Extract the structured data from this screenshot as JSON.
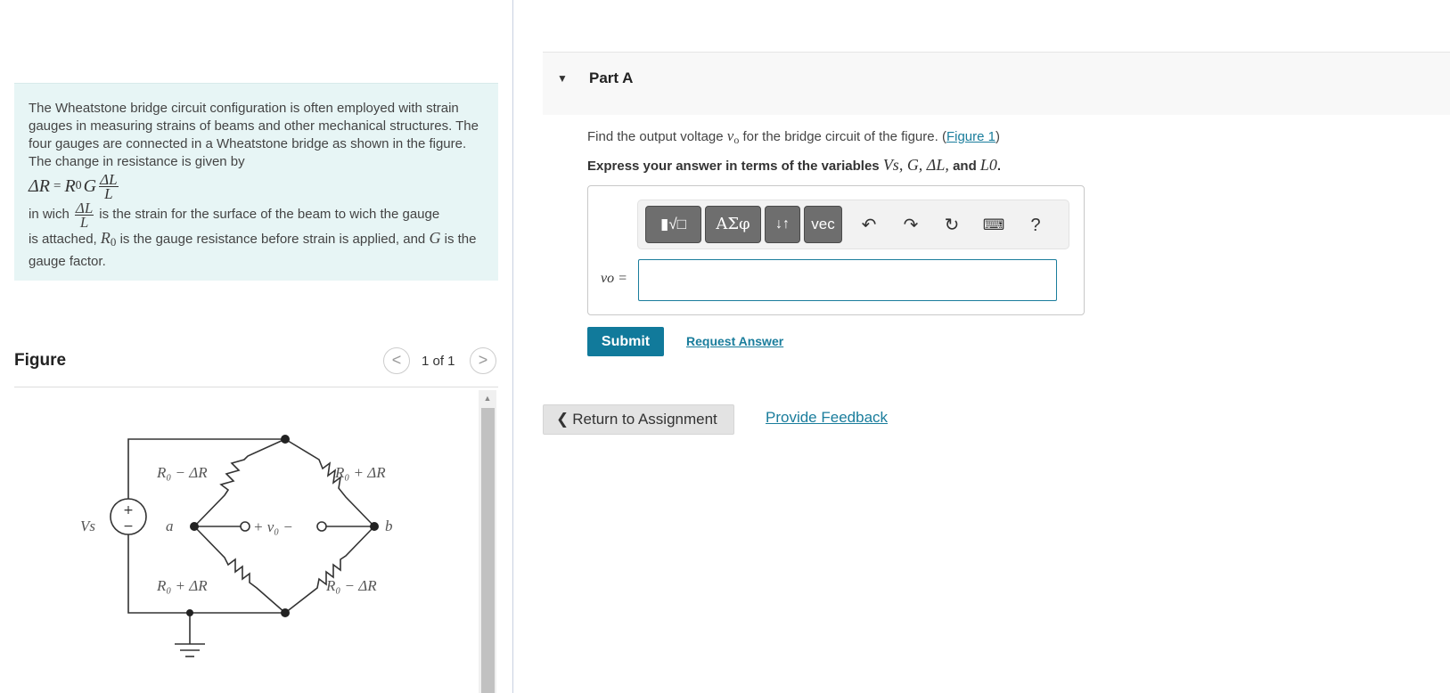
{
  "problem": {
    "intro": "The Wheatstone bridge circuit configuration is often employed with strain gauges in measuring strains of beams and other mechanical structures. The four gauges are connected in a Wheatstone bridge as shown in the figure. The change in resistance is given by",
    "eq_lhs": "ΔR",
    "eq_equals": "=",
    "eq_r0": "R",
    "eq_r0_sub": "0",
    "eq_g": "G",
    "frac_num": "ΔL",
    "frac_den": "L",
    "strain_prefix": "in wich",
    "strain_suffix": "is the strain for the surface of the beam to wich the gauge",
    "tail_1": "is attached,",
    "tail_r0": "R",
    "tail_r0_sub": "0",
    "tail_2": "is the gauge resistance before strain is applied, and",
    "tail_g": "G",
    "tail_3": "is the gauge factor."
  },
  "figure": {
    "title": "Figure",
    "prev": "<",
    "next": ">",
    "page": "1 of 1",
    "labels": {
      "top_left": "R₀ − ΔR",
      "top_right": "R₀ + ΔR",
      "bottom_left": "R₀ + ΔR",
      "bottom_right": "R₀ − ΔR",
      "source": "Vs",
      "source_plus": "+",
      "source_minus": "−",
      "node_a": "a",
      "node_b": "b",
      "vo": "+  v₀  −"
    }
  },
  "part": {
    "caret": "▼",
    "title": "Part A"
  },
  "question": {
    "text_before": "Find the output voltage",
    "var": "v",
    "var_sub": "o",
    "text_after": "for the bridge circuit of the figure. (",
    "link": "Figure 1",
    "close": ")"
  },
  "instruction": {
    "prefix": "Express your answer in terms of the variables",
    "vars": "Vs, G, ΔL,",
    "and": "and",
    "last_var": "L0",
    "period": "."
  },
  "toolbar": {
    "templates": "▮√□",
    "greek": "ΑΣφ",
    "arrows": "↓↑",
    "vec": "vec",
    "undo": "↶",
    "redo": "↷",
    "reset": "↻",
    "keyboard": "⌨",
    "help": "?"
  },
  "answer": {
    "label": "vo =",
    "value": ""
  },
  "actions": {
    "submit": "Submit",
    "request": "Request Answer",
    "return": "Return to Assignment",
    "return_chevron": "❮",
    "feedback": "Provide Feedback"
  }
}
